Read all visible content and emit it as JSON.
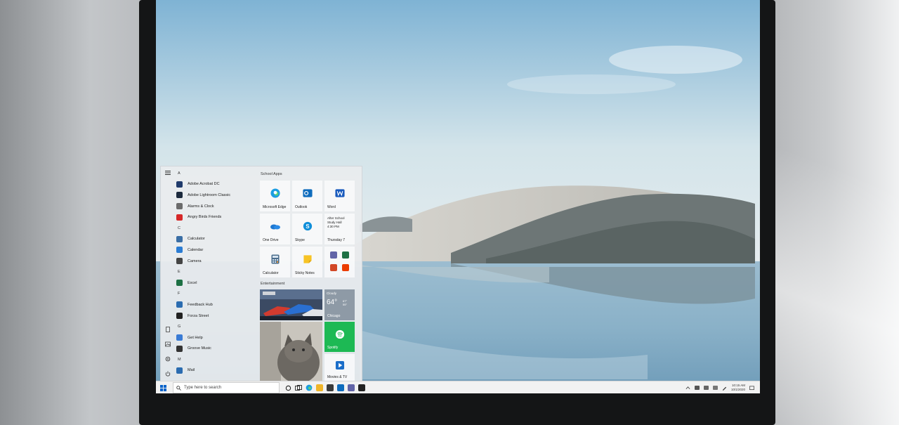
{
  "start_menu": {
    "app_list": [
      {
        "type": "header",
        "label": "A"
      },
      {
        "type": "app",
        "label": "Adobe Acrobat DC",
        "icon": "acrobat-icon",
        "color": "#1f3a6b"
      },
      {
        "type": "app",
        "label": "Adobe Lightroom Classic",
        "icon": "lightroom-icon",
        "color": "#1c2a3d"
      },
      {
        "type": "app",
        "label": "Alarms & Clock",
        "icon": "alarm-clock-icon",
        "color": "#6b6b6b"
      },
      {
        "type": "app",
        "label": "Angry Birds Friends",
        "icon": "angry-birds-icon",
        "color": "#d62828"
      },
      {
        "type": "header",
        "label": "C"
      },
      {
        "type": "app",
        "label": "Calculator",
        "icon": "calculator-icon",
        "color": "#3a6ea5"
      },
      {
        "type": "app",
        "label": "Calendar",
        "icon": "calendar-icon",
        "color": "#2b7cd3"
      },
      {
        "type": "app",
        "label": "Camera",
        "icon": "camera-icon",
        "color": "#444444"
      },
      {
        "type": "header",
        "label": "E"
      },
      {
        "type": "app",
        "label": "Excel",
        "icon": "excel-icon",
        "color": "#1d7044"
      },
      {
        "type": "header",
        "label": "F"
      },
      {
        "type": "app",
        "label": "Feedback Hub",
        "icon": "feedback-hub-icon",
        "color": "#2b6cb0"
      },
      {
        "type": "app",
        "label": "Forza Street",
        "icon": "forza-street-icon",
        "color": "#222222"
      },
      {
        "type": "header",
        "label": "G"
      },
      {
        "type": "app",
        "label": "Get Help",
        "icon": "help-icon",
        "color": "#3a7bd5"
      },
      {
        "type": "app",
        "label": "Groove Music",
        "icon": "groove-music-icon",
        "color": "#333333"
      },
      {
        "type": "header",
        "label": "M"
      },
      {
        "type": "app",
        "label": "Mail",
        "icon": "mail-icon",
        "color": "#2b6cb0"
      }
    ],
    "school_group": "School Apps",
    "entertainment_group": "Entertainment",
    "tiles": {
      "edge": "Microsoft Edge",
      "outlook": "Outlook",
      "word": "Word",
      "onedrive": "One Drive",
      "skype": "Skype",
      "calendar_tile": [
        "After School",
        "Study Hall",
        "4:30 PM",
        "Thursday 7"
      ],
      "calculator": "Calculator",
      "sticky_notes": "Sticky Notes",
      "weather": {
        "top": "Cloudy",
        "temp": "64°",
        "hi": "67°",
        "lo": "55°",
        "city": "Chicago"
      },
      "spotify": "Spotify",
      "movies": "Movies & TV"
    }
  },
  "taskbar": {
    "search_placeholder": "Type here to search",
    "time": "10:15 AM",
    "date": "10/1/2020"
  }
}
